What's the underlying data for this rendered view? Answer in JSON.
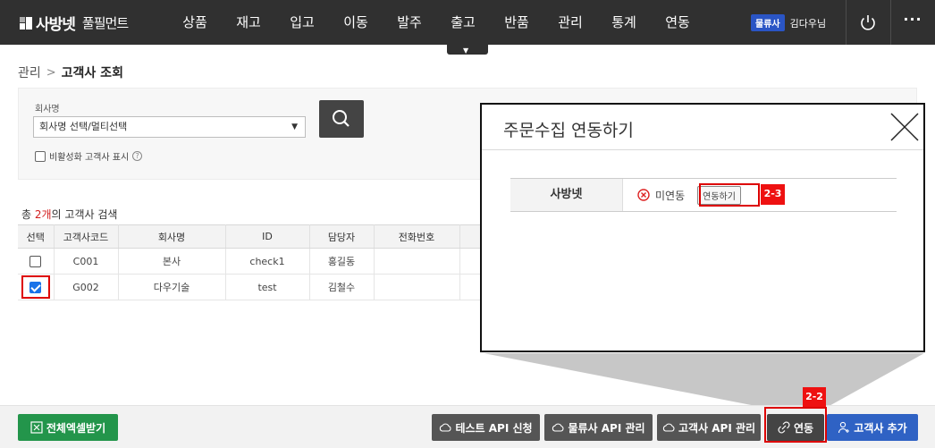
{
  "topbar": {
    "logo_main": "사방넷",
    "logo_sub": "풀필먼트",
    "nav": [
      "상품",
      "재고",
      "입고",
      "이동",
      "발주",
      "출고",
      "반품",
      "관리",
      "통계",
      "연동"
    ],
    "user_badge": "물류사",
    "user_name": "김다우님"
  },
  "breadcrumb": {
    "parent": "관리",
    "current": "고객사 조회"
  },
  "search": {
    "company_label": "회사명",
    "company_select_value": "회사명 선택/멀티선택",
    "inactive_label": "비활성화 고객사 표시"
  },
  "result": {
    "count_prefix": "총 ",
    "count_num": "2개",
    "count_suffix": "의 고객사 검색"
  },
  "grid": {
    "headers": [
      "선택",
      "고객사코드",
      "회사명",
      "ID",
      "담당자",
      "전화번호",
      ""
    ],
    "rows": [
      {
        "code": "C001",
        "name": "본사",
        "id": "check1",
        "manager": "홍길동",
        "phone": ""
      },
      {
        "code": "G002",
        "name": "다우기술",
        "id": "test",
        "manager": "김철수",
        "phone": ""
      }
    ]
  },
  "modal": {
    "title": "주문수집 연동하기",
    "row_label": "사방넷",
    "status": "미연동",
    "connect_button": "연동하기",
    "callout_tag": "2-3"
  },
  "bottom": {
    "excel": "전체엑셀받기",
    "test_api": "테스트 API 신청",
    "logistics_api": "물류사 API 관리",
    "client_api": "고객사 API 관리",
    "link": "연동",
    "add_client": "고객사 추가",
    "callout_tag": "2-2"
  },
  "colors": {
    "topbar": "#303030",
    "excel_green": "#23954b",
    "primary_blue": "#2f62c4",
    "highlight_red": "#dd0000",
    "badge_blue": "#2a55c5"
  }
}
